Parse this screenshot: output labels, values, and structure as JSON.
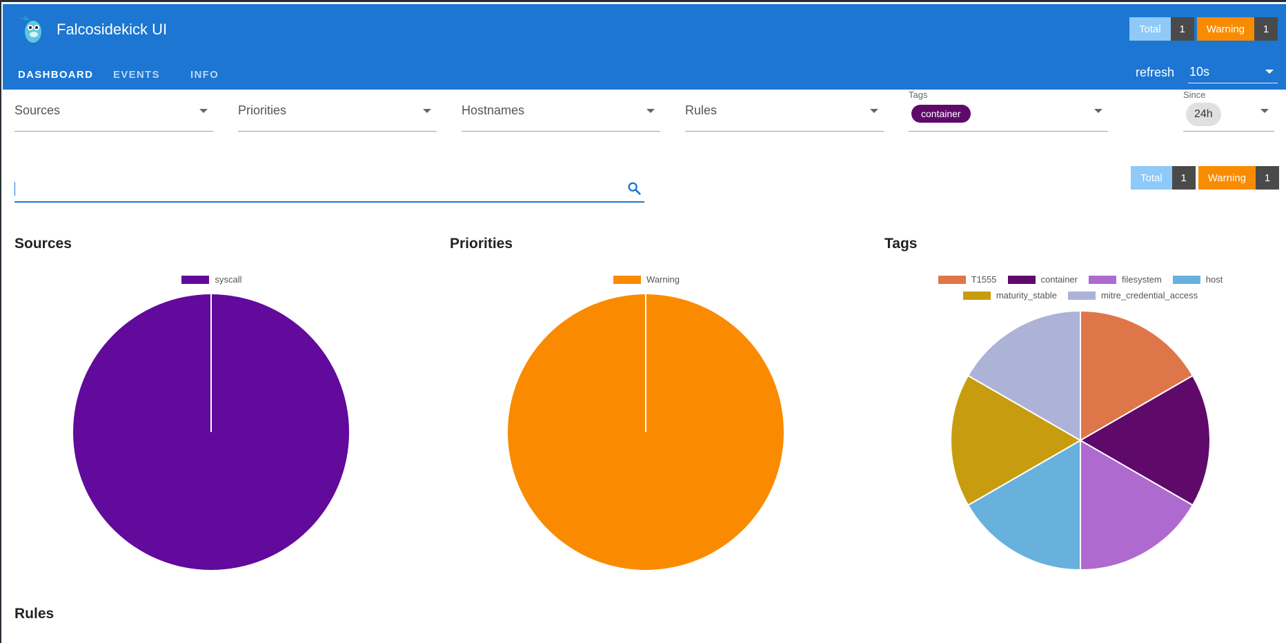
{
  "app": {
    "title": "Falcosidekick UI"
  },
  "header_counts": {
    "total_label": "Total",
    "total_count": "1",
    "warning_label": "Warning",
    "warning_count": "1"
  },
  "tabs": [
    {
      "label": "DASHBOARD",
      "active": true
    },
    {
      "label": "EVENTS",
      "active": false
    },
    {
      "label": "INFO",
      "active": false
    }
  ],
  "refresh": {
    "label": "refresh",
    "value": "10s"
  },
  "filters": {
    "sources": "Sources",
    "priorities": "Priorities",
    "hostnames": "Hostnames",
    "rules": "Rules",
    "tags_label": "Tags",
    "tags_selected": "container",
    "since_label": "Since",
    "since_value": "24h"
  },
  "search": {
    "value": "",
    "placeholder": ""
  },
  "summary_counts": {
    "total_label": "Total",
    "total_count": "1",
    "warning_label": "Warning",
    "warning_count": "1"
  },
  "sections": {
    "sources": "Sources",
    "priorities": "Priorities",
    "tags": "Tags",
    "rules": "Rules"
  },
  "colors": {
    "primary": "#1c76d2",
    "warning": "#f98b00",
    "total": "#8ec9f8",
    "syscall": "#620a9c"
  },
  "chart_data": [
    {
      "type": "pie",
      "title": "Sources",
      "labels": [
        "syscall"
      ],
      "values": [
        1
      ],
      "colors": [
        "#620a9c"
      ],
      "legend": "top"
    },
    {
      "type": "pie",
      "title": "Priorities",
      "labels": [
        "Warning"
      ],
      "values": [
        1
      ],
      "colors": [
        "#fa8b00"
      ],
      "legend": "top"
    },
    {
      "type": "pie",
      "title": "Tags",
      "labels": [
        "T1555",
        "container",
        "filesystem",
        "host",
        "maturity_stable",
        "mitre_credential_access"
      ],
      "values": [
        1,
        1,
        1,
        1,
        1,
        1
      ],
      "colors": [
        "#df764a",
        "#5f0a6b",
        "#af6ad0",
        "#68b1dc",
        "#c79d0f",
        "#adb2d7"
      ],
      "legend": "top"
    }
  ]
}
